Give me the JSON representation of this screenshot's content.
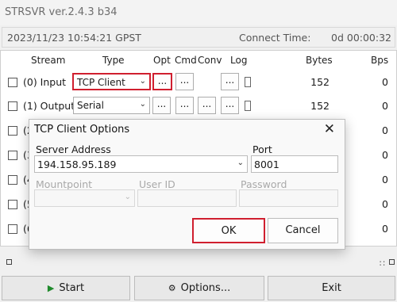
{
  "window": {
    "title": "STRSVR ver.2.4.3 b34"
  },
  "status": {
    "timestamp": "2023/11/23 10:54:21 GPST",
    "connect_label": "Connect Time:",
    "connect_time": "0d 00:00:32"
  },
  "table": {
    "headers": {
      "stream": "Stream",
      "type": "Type",
      "opt": "Opt",
      "cmd": "Cmd",
      "conv": "Conv",
      "log": "Log",
      "bytes": "Bytes",
      "bps": "Bps"
    },
    "rows": [
      {
        "label": "(0) Input",
        "type": "TCP Client",
        "bytes": "152",
        "bps": "0"
      },
      {
        "label": "(1) Output",
        "type": "Serial",
        "bytes": "152",
        "bps": "0"
      },
      {
        "label": "(2"
      },
      {
        "label": "(3"
      },
      {
        "label": "(4"
      },
      {
        "label": "(5"
      },
      {
        "label": "(6"
      }
    ],
    "dots": "..."
  },
  "buttons": {
    "start": "Start",
    "options": "Options...",
    "exit": "Exit"
  },
  "dialog": {
    "title": "TCP Client Options",
    "server_label": "Server Address",
    "server_value": "194.158.95.189",
    "port_label": "Port",
    "port_value": "8001",
    "mountpoint_label": "Mountpoint",
    "userid_label": "User ID",
    "password_label": "Password",
    "ok": "OK",
    "cancel": "Cancel"
  },
  "colors": {
    "highlight": "#d01f2f",
    "start_icon": "#1f8a2c"
  },
  "icons": [
    "close-icon",
    "play-icon",
    "gear-icon",
    "chevron-down-icon"
  ]
}
